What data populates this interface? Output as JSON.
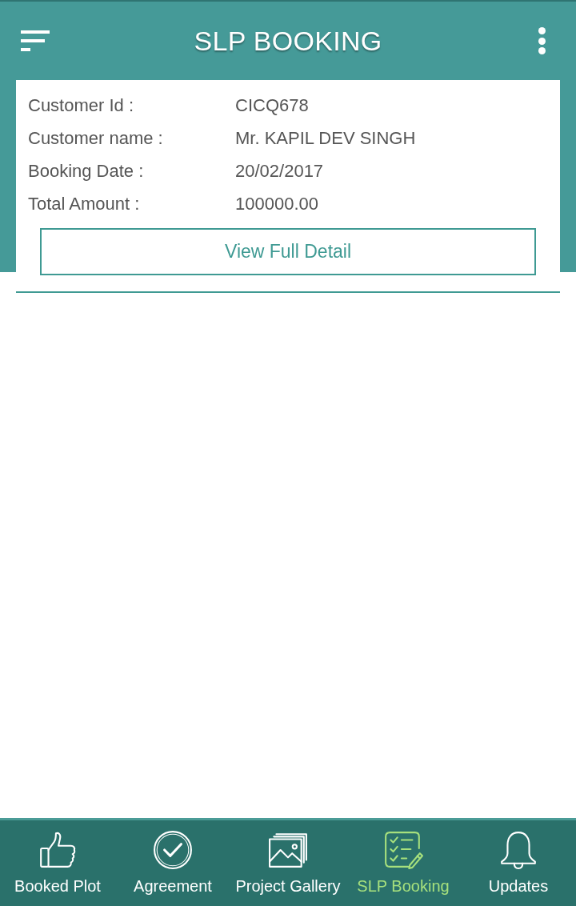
{
  "app_bar": {
    "title": "SLP BOOKING"
  },
  "booking": {
    "fields": [
      {
        "label": "Customer Id :",
        "value": "CICQ678"
      },
      {
        "label": "Customer name :",
        "value": "Mr. KAPIL DEV SINGH"
      },
      {
        "label": "Booking Date :",
        "value": "20/02/2017"
      },
      {
        "label": "Total Amount :",
        "value": "100000.00"
      }
    ],
    "button": "View Full Detail"
  },
  "bottom_nav": [
    {
      "label": "Booked Plot",
      "kind": "like",
      "selected": false
    },
    {
      "label": "Agreement",
      "kind": "check",
      "selected": false
    },
    {
      "label": "Project Gallery",
      "kind": "gallery",
      "selected": false
    },
    {
      "label": "SLP Booking",
      "kind": "checklist",
      "selected": true
    },
    {
      "label": "Updates",
      "kind": "bell",
      "selected": false
    }
  ]
}
